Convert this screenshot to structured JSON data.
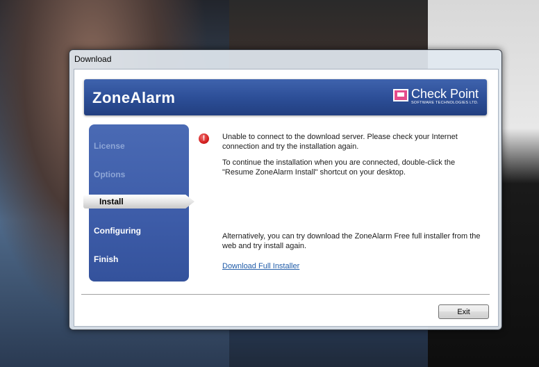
{
  "window": {
    "title": "Download"
  },
  "banner": {
    "product_logo": "ZoneAlarm",
    "vendor_logo": "Check Point",
    "vendor_sub": "SOFTWARE TECHNOLOGIES LTD."
  },
  "steps": [
    {
      "label": "License",
      "state": "done"
    },
    {
      "label": "Options",
      "state": "done"
    },
    {
      "label": "Install",
      "state": "active"
    },
    {
      "label": "Configuring",
      "state": "pending"
    },
    {
      "label": "Finish",
      "state": "pending"
    }
  ],
  "content": {
    "error_icon": "error-icon",
    "error_text": "Unable to connect to the download server. Please check your Internet connection and try the installation again.",
    "resume_text": "To continue the installation when you are connected, double-click the \"Resume ZoneAlarm Install\" shortcut on your desktop.",
    "alt_text": "Alternatively, you can try download the ZoneAlarm Free full installer from the web and try install again.",
    "download_link": "Download Full Installer"
  },
  "buttons": {
    "exit": "Exit"
  },
  "colors": {
    "banner": "#2d4f98",
    "sidebar": "#3d5ca8",
    "link": "#1f5ba8",
    "error": "#d42020"
  }
}
